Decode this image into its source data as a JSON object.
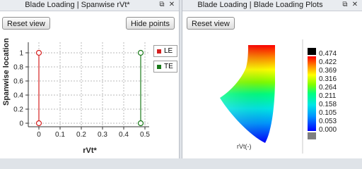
{
  "panels": {
    "left": {
      "title": "Blade Loading | Spanwise rVt*",
      "reset_label": "Reset view",
      "hide_label": "Hide points"
    },
    "right": {
      "title": "Blade Loading | Blade Loading Plots",
      "reset_label": "Reset view"
    }
  },
  "icons": {
    "restore": "restore-window-icon",
    "close": "close-icon"
  },
  "chart_data": [
    {
      "type": "line",
      "xlabel": "rVt*",
      "ylabel": "Spanwise location",
      "xlim": [
        -0.05,
        0.52
      ],
      "ylim": [
        -0.05,
        1.15
      ],
      "x_ticks": [
        "0",
        "0.1",
        "0.2",
        "0.3",
        "0.4",
        "0.5"
      ],
      "y_ticks": [
        "0",
        "0.2",
        "0.4",
        "0.6",
        "0.8",
        "1"
      ],
      "grid": true,
      "legend_position": "right",
      "series": [
        {
          "name": "LE",
          "color": "#d42020",
          "points": [
            [
              0,
              0
            ],
            [
              0,
              1
            ]
          ]
        },
        {
          "name": "TE",
          "color": "#1a7a1a",
          "points": [
            [
              0.48,
              0
            ],
            [
              0.48,
              1
            ]
          ]
        }
      ]
    },
    {
      "type": "heatmap",
      "label": "rVt(-)",
      "colorbar": {
        "ticks": [
          "0.474",
          "0.422",
          "0.369",
          "0.316",
          "0.264",
          "0.211",
          "0.158",
          "0.105",
          "0.053",
          "0.000"
        ],
        "above_color": "#000000",
        "below_color": "#808080"
      }
    }
  ]
}
